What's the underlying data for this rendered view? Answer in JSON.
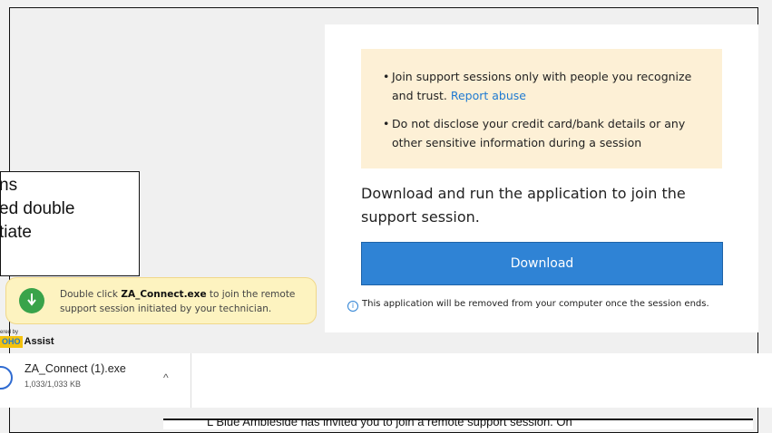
{
  "warning": {
    "bullets": [
      {
        "text": "Join support sessions only with people you recognize and trust.",
        "link": "Report abuse"
      },
      {
        "text": "Do not disclose your credit card/bank details or any other sensitive information during a session",
        "link": ""
      }
    ]
  },
  "main": {
    "heading": "Download and run the application to join the support session.",
    "download_label": "Download",
    "info_text": "This application will be removed from your computer once the session ends.",
    "info_icon": "i"
  },
  "callout": {
    "lines": [
      "ns",
      "ed double",
      "tiate"
    ]
  },
  "toast": {
    "prefix": "Double click ",
    "file": "ZA_Connect.exe",
    "suffix": " to join the remote support session initiated by your technician."
  },
  "powered": {
    "small": "ered by",
    "logo": "OHO",
    "brand": "Assist"
  },
  "download_bar": {
    "file_name": "ZA_Connect (1).exe",
    "size": "1,033/1,033 KB",
    "chevron": "^"
  },
  "bottom_text": "L Blue Ambleside has invited you to join a remote support session. On",
  "colors": {
    "accent": "#2f83d5",
    "warning_bg": "#fdf0d6",
    "toast_bg": "#fdf3c0",
    "success": "#39a34a"
  }
}
